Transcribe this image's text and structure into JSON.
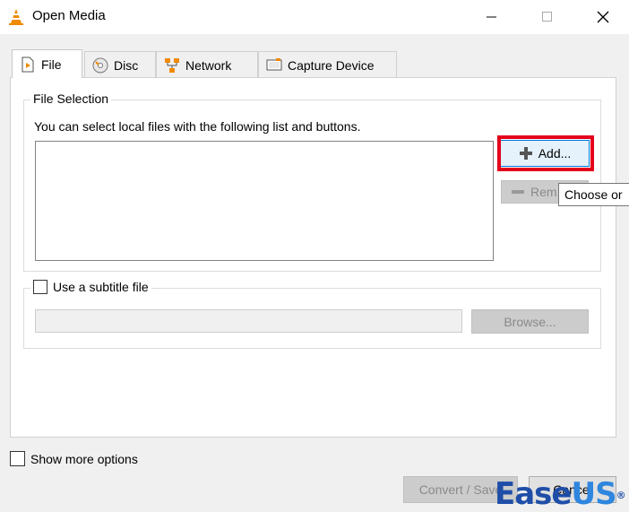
{
  "window": {
    "title": "Open Media",
    "minimize_glyph": "—",
    "maximize_glyph": "☐",
    "close_glyph": "✕"
  },
  "tabs": [
    {
      "label": "File",
      "icon": "file-play-icon",
      "active": true
    },
    {
      "label": "Disc",
      "icon": "disc-icon",
      "active": false
    },
    {
      "label": "Network",
      "icon": "network-icon",
      "active": false
    },
    {
      "label": "Capture Device",
      "icon": "capture-device-icon",
      "active": false
    }
  ],
  "file_selection": {
    "group_title": "File Selection",
    "hint": "You can select local files with the following list and buttons.",
    "add_label": "Add...",
    "remove_label": "Rem",
    "tooltip": "Choose or"
  },
  "subtitle": {
    "checkbox_label": "Use a subtitle file",
    "checked": false,
    "path_value": "",
    "browse_label": "Browse..."
  },
  "options": {
    "show_more_label": "Show more options",
    "checked": false
  },
  "footer": {
    "convert_label": "Convert / Save",
    "cancel_label": "Cancel"
  },
  "watermark": {
    "part1": "Ease",
    "part2": "US",
    "reg": "®"
  },
  "colors": {
    "highlight": "#e3001b",
    "vlc_orange": "#f08a00",
    "brand_blue": "#1e4ea8"
  }
}
